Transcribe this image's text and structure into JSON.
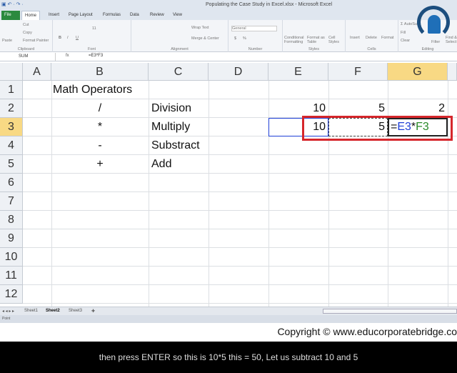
{
  "window": {
    "title": "Populating the Case Study in Excel.xlsx - Microsoft Excel",
    "qat": "▣ ↶ · ↷ ·"
  },
  "ribbon_tabs": [
    "File",
    "Home",
    "Insert",
    "Page Layout",
    "Formulas",
    "Data",
    "Review",
    "View"
  ],
  "ribbon": {
    "clipboard": {
      "label": "Clipboard",
      "paste": "Paste",
      "cut": "Cut",
      "copy": "Copy",
      "format_painter": "Format Painter"
    },
    "font": {
      "label": "Font",
      "size": "11",
      "bold": "B",
      "italic": "I",
      "underline": "U"
    },
    "alignment": {
      "label": "Alignment",
      "wrap": "Wrap Text",
      "merge": "Merge & Center"
    },
    "number": {
      "label": "Number",
      "format": "General",
      "currency": "$",
      "percent": "%"
    },
    "styles": {
      "label": "Styles",
      "conditional": "Conditional Formatting",
      "format_table": "Format as Table",
      "cell_styles": "Cell Styles"
    },
    "cells": {
      "label": "Cells",
      "insert": "Insert",
      "delete": "Delete",
      "format": "Format"
    },
    "editing": {
      "label": "Editing",
      "autosum": "Σ AutoSum",
      "fill": "Fill",
      "clear": "Clear",
      "filter": "Filter",
      "find": "Find & Select"
    }
  },
  "formula_bar": {
    "name_box": "SUM",
    "fx": "fx",
    "formula": "=E3*F3"
  },
  "columns": [
    "A",
    "B",
    "C",
    "D",
    "E",
    "F",
    "G"
  ],
  "rows": [
    "1",
    "2",
    "3",
    "4",
    "5",
    "6",
    "7",
    "8",
    "9",
    "10",
    "11",
    "12"
  ],
  "cells": {
    "B1": "Math Operators",
    "B2": "/",
    "C2": "Division",
    "B3": "*",
    "C3": "Multiply",
    "B4": "-",
    "C4": "Substract",
    "B5": "+",
    "C5": "Add",
    "E2": "10",
    "F2": "5",
    "G2": "2",
    "E3": "10",
    "F3": "5",
    "G3_parts": [
      "=",
      "E3",
      "*",
      "F3"
    ]
  },
  "colors": {
    "ref1": "#1f3fd6",
    "ref2": "#2a8a2a",
    "highlight": "#d6262b"
  },
  "sheets": [
    "Sheet1",
    "Sheet2",
    "Sheet3"
  ],
  "status": "Point",
  "copyright": "Copyright © www.educorporatebridge.co",
  "caption": "then press ENTER so this is 10*5 this = 50, Let us subtract 10 and 5"
}
